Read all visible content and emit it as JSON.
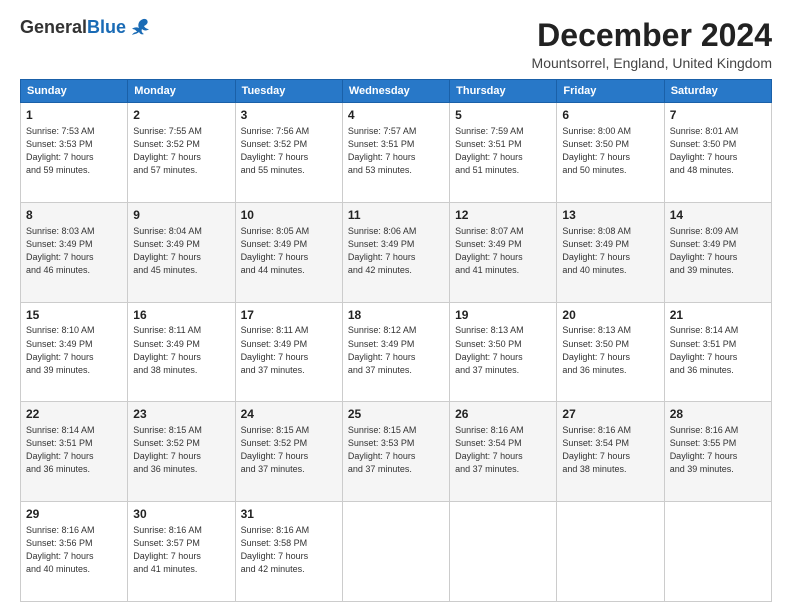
{
  "logo": {
    "general": "General",
    "blue": "Blue"
  },
  "title": "December 2024",
  "subtitle": "Mountsorrel, England, United Kingdom",
  "days_of_week": [
    "Sunday",
    "Monday",
    "Tuesday",
    "Wednesday",
    "Thursday",
    "Friday",
    "Saturday"
  ],
  "weeks": [
    [
      {
        "day": "1",
        "info": "Sunrise: 7:53 AM\nSunset: 3:53 PM\nDaylight: 7 hours\nand 59 minutes."
      },
      {
        "day": "2",
        "info": "Sunrise: 7:55 AM\nSunset: 3:52 PM\nDaylight: 7 hours\nand 57 minutes."
      },
      {
        "day": "3",
        "info": "Sunrise: 7:56 AM\nSunset: 3:52 PM\nDaylight: 7 hours\nand 55 minutes."
      },
      {
        "day": "4",
        "info": "Sunrise: 7:57 AM\nSunset: 3:51 PM\nDaylight: 7 hours\nand 53 minutes."
      },
      {
        "day": "5",
        "info": "Sunrise: 7:59 AM\nSunset: 3:51 PM\nDaylight: 7 hours\nand 51 minutes."
      },
      {
        "day": "6",
        "info": "Sunrise: 8:00 AM\nSunset: 3:50 PM\nDaylight: 7 hours\nand 50 minutes."
      },
      {
        "day": "7",
        "info": "Sunrise: 8:01 AM\nSunset: 3:50 PM\nDaylight: 7 hours\nand 48 minutes."
      }
    ],
    [
      {
        "day": "8",
        "info": "Sunrise: 8:03 AM\nSunset: 3:49 PM\nDaylight: 7 hours\nand 46 minutes."
      },
      {
        "day": "9",
        "info": "Sunrise: 8:04 AM\nSunset: 3:49 PM\nDaylight: 7 hours\nand 45 minutes."
      },
      {
        "day": "10",
        "info": "Sunrise: 8:05 AM\nSunset: 3:49 PM\nDaylight: 7 hours\nand 44 minutes."
      },
      {
        "day": "11",
        "info": "Sunrise: 8:06 AM\nSunset: 3:49 PM\nDaylight: 7 hours\nand 42 minutes."
      },
      {
        "day": "12",
        "info": "Sunrise: 8:07 AM\nSunset: 3:49 PM\nDaylight: 7 hours\nand 41 minutes."
      },
      {
        "day": "13",
        "info": "Sunrise: 8:08 AM\nSunset: 3:49 PM\nDaylight: 7 hours\nand 40 minutes."
      },
      {
        "day": "14",
        "info": "Sunrise: 8:09 AM\nSunset: 3:49 PM\nDaylight: 7 hours\nand 39 minutes."
      }
    ],
    [
      {
        "day": "15",
        "info": "Sunrise: 8:10 AM\nSunset: 3:49 PM\nDaylight: 7 hours\nand 39 minutes."
      },
      {
        "day": "16",
        "info": "Sunrise: 8:11 AM\nSunset: 3:49 PM\nDaylight: 7 hours\nand 38 minutes."
      },
      {
        "day": "17",
        "info": "Sunrise: 8:11 AM\nSunset: 3:49 PM\nDaylight: 7 hours\nand 37 minutes."
      },
      {
        "day": "18",
        "info": "Sunrise: 8:12 AM\nSunset: 3:49 PM\nDaylight: 7 hours\nand 37 minutes."
      },
      {
        "day": "19",
        "info": "Sunrise: 8:13 AM\nSunset: 3:50 PM\nDaylight: 7 hours\nand 37 minutes."
      },
      {
        "day": "20",
        "info": "Sunrise: 8:13 AM\nSunset: 3:50 PM\nDaylight: 7 hours\nand 36 minutes."
      },
      {
        "day": "21",
        "info": "Sunrise: 8:14 AM\nSunset: 3:51 PM\nDaylight: 7 hours\nand 36 minutes."
      }
    ],
    [
      {
        "day": "22",
        "info": "Sunrise: 8:14 AM\nSunset: 3:51 PM\nDaylight: 7 hours\nand 36 minutes."
      },
      {
        "day": "23",
        "info": "Sunrise: 8:15 AM\nSunset: 3:52 PM\nDaylight: 7 hours\nand 36 minutes."
      },
      {
        "day": "24",
        "info": "Sunrise: 8:15 AM\nSunset: 3:52 PM\nDaylight: 7 hours\nand 37 minutes."
      },
      {
        "day": "25",
        "info": "Sunrise: 8:15 AM\nSunset: 3:53 PM\nDaylight: 7 hours\nand 37 minutes."
      },
      {
        "day": "26",
        "info": "Sunrise: 8:16 AM\nSunset: 3:54 PM\nDaylight: 7 hours\nand 37 minutes."
      },
      {
        "day": "27",
        "info": "Sunrise: 8:16 AM\nSunset: 3:54 PM\nDaylight: 7 hours\nand 38 minutes."
      },
      {
        "day": "28",
        "info": "Sunrise: 8:16 AM\nSunset: 3:55 PM\nDaylight: 7 hours\nand 39 minutes."
      }
    ],
    [
      {
        "day": "29",
        "info": "Sunrise: 8:16 AM\nSunset: 3:56 PM\nDaylight: 7 hours\nand 40 minutes."
      },
      {
        "day": "30",
        "info": "Sunrise: 8:16 AM\nSunset: 3:57 PM\nDaylight: 7 hours\nand 41 minutes."
      },
      {
        "day": "31",
        "info": "Sunrise: 8:16 AM\nSunset: 3:58 PM\nDaylight: 7 hours\nand 42 minutes."
      },
      {
        "day": "",
        "info": ""
      },
      {
        "day": "",
        "info": ""
      },
      {
        "day": "",
        "info": ""
      },
      {
        "day": "",
        "info": ""
      }
    ]
  ]
}
